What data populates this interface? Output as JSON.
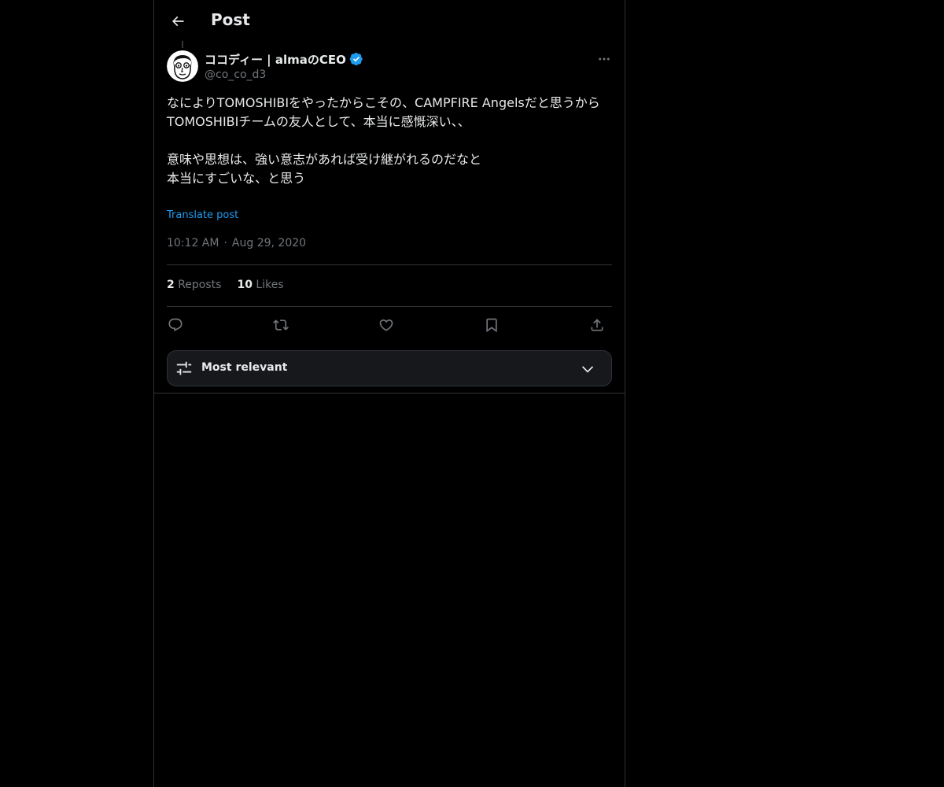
{
  "header": {
    "back_icon": "arrow-left-icon",
    "title": "Post"
  },
  "post": {
    "author": {
      "name": "ココディー | almaのCEO",
      "handle": "@co_co_d3",
      "verified": true,
      "verified_color": "#1d9bf0"
    },
    "text": "なによりTOMOSHIBIをやったからこその、CAMPFIRE Angelsだと思うから\nTOMOSHIBIチームの友人として、本当に感慨深い、、\n\n意味や思想は、強い意志があれば受け継がれるのだなと\n本当にすごいな、と思う",
    "translate_label": "Translate post",
    "time": "10:12 AM",
    "separator": "·",
    "date": "Aug 29, 2020",
    "stats": {
      "reposts_count": "2",
      "reposts_label": "Reposts",
      "likes_count": "10",
      "likes_label": "Likes"
    },
    "actions": [
      "reply-icon",
      "repost-icon",
      "like-icon",
      "bookmark-icon",
      "share-icon"
    ]
  },
  "replies_sort": {
    "icon": "sliders-icon",
    "label": "Most relevant",
    "chevron": "chevron-down-icon"
  },
  "colors": {
    "background": "#000000",
    "text": "#e7e9ea",
    "secondary_text": "#71767b",
    "link": "#1d9bf0",
    "border": "#2f3336"
  }
}
